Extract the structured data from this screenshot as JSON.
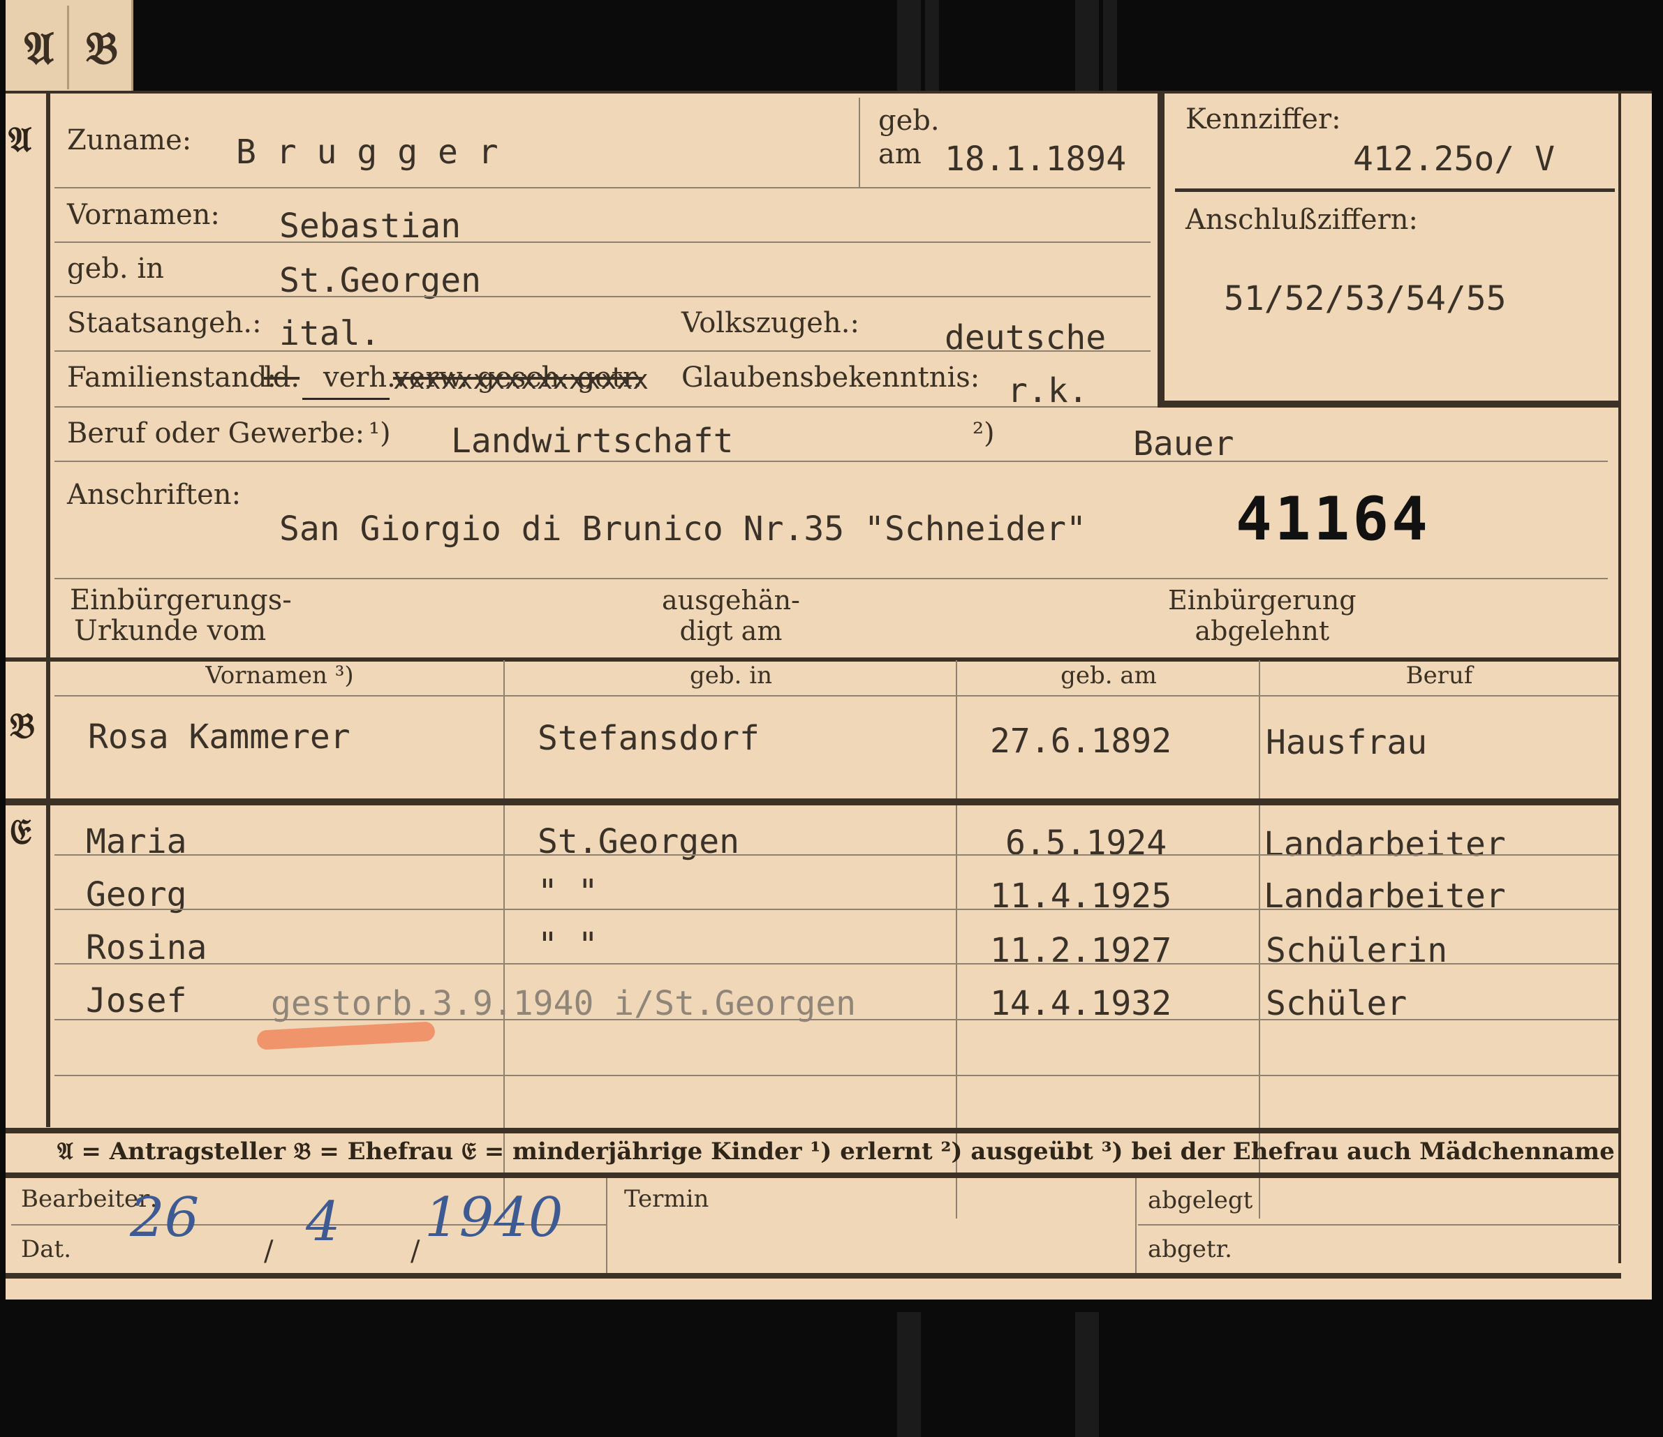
{
  "tabs": [
    "𝔄",
    "𝔅"
  ],
  "section_a": {
    "marker": "𝔄",
    "surname_label": "Zuname:",
    "surname": "B r u g g e r",
    "born_on_label_1": "geb.",
    "born_on_label_2": "am",
    "born_on": "18.1.1894",
    "file_number_label": "Kennziffer:",
    "file_number": "412.25o/ V",
    "linked_numbers_label": "Anschlußziffern:",
    "linked_numbers": "51/52/53/54/55",
    "first_names_label": "Vornamen:",
    "first_names": "Sebastian",
    "birthplace_label": "geb. in",
    "birthplace": "St.Georgen",
    "citizenship_label": "Staatsangeh.:",
    "citizenship": "ital.",
    "ethnicity_label": "Volkszugeh.:",
    "ethnicity": "deutsche",
    "marital_status_label": "Familienstand:",
    "marital_status_struck_1": "ld.",
    "marital_status_selected": "verh.",
    "marital_status_struck_2": "verw. gesch. getr.",
    "marital_status_xs": "xxxxxxxxxxxxxxxx",
    "religion_label": "Glaubensbekenntnis:",
    "religion": "r.k.",
    "occupation_label": "Beruf oder Gewerbe:",
    "occupation_sup_1": "¹)",
    "occupation_learned": "Landwirtschaft",
    "occupation_sup_2": "²)",
    "occupation_practiced": "Bauer",
    "address_label": "Anschriften:",
    "address": "San Giorgio di Brunico Nr.35 \"Schneider\"",
    "stamp_number": "41164",
    "naturalization_cert_label_1": "Einbürgerungs-",
    "naturalization_cert_label_2": "Urkunde vom",
    "handed_over_label_1": "ausgehän-",
    "handed_over_label_2": "digt am",
    "naturalization_denied_label_1": "Einbürgerung",
    "naturalization_denied_label_2": "abgelehnt"
  },
  "section_b": {
    "marker": "𝔅",
    "headers": [
      "Vornamen ³)",
      "geb. in",
      "geb. am",
      "Beruf"
    ],
    "row": [
      "Rosa Kammerer",
      "Stefansdorf",
      "27.6.1892",
      "Hausfrau"
    ]
  },
  "section_c": {
    "marker": "𝔈",
    "rows": [
      {
        "name": "Maria",
        "place": "St.Georgen",
        "date": "6.5.1924",
        "occupation": "Landarbeiter"
      },
      {
        "name": "Georg",
        "place": "\"      \"",
        "date": "11.4.1925",
        "occupation": "Landarbeiter"
      },
      {
        "name": "Rosina",
        "place": "\"      \"",
        "date": "11.2.1927",
        "occupation": "Schülerin"
      },
      {
        "name": "Josef",
        "note": "gestorb.3.9.1940 i/St.Georgen",
        "date": "14.4.1932",
        "occupation": "Schüler"
      }
    ]
  },
  "legend": "𝔄 = Antragsteller   𝔅 = Ehefrau   𝔈 = minderjährige Kinder   ¹) erlernt   ²) ausgeübt   ³) bei der Ehefrau auch Mädchenname",
  "footer": {
    "processor_label": "Bearbeiter:",
    "date_label": "Dat.",
    "date_day": "26",
    "date_month": "4",
    "date_year": "1940",
    "date_sep": "/",
    "appointment_label": "Termin",
    "filed_label": "abgelegt",
    "separated_label": "abgetr."
  },
  "colors": {
    "card": "#efd7b8",
    "ink_typed": "#3a3128",
    "ink_hand": "#3d5a93",
    "highlight": "#f08a5d",
    "background": "#0b0b0b"
  }
}
